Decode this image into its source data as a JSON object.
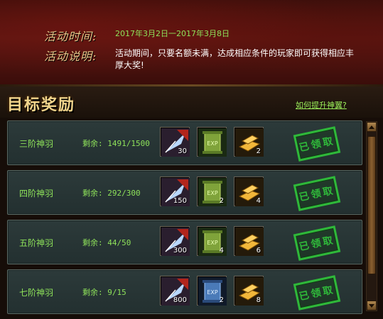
{
  "header": {
    "time_label": "活动时间:",
    "time_value": "2017年3月2日一2017年3月8日",
    "desc_label": "活动说明:",
    "desc_value": "活动期间，只要名额未满，达成相应条件的玩家即可获得相应丰厚大奖!"
  },
  "section": {
    "title": "目标奖励",
    "link": "如何提升神翼?"
  },
  "rewards": [
    {
      "tier": "三阶神羽",
      "remain": "剩余: 1491/1500",
      "items": [
        {
          "icon": "feather-icon",
          "qty": "30"
        },
        {
          "icon": "exp-scroll-icon",
          "qty": ""
        },
        {
          "icon": "gold-bar-icon",
          "qty": "2"
        }
      ],
      "stamp": "已领取"
    },
    {
      "tier": "四阶神羽",
      "remain": "剩余: 292/300",
      "items": [
        {
          "icon": "feather-icon",
          "qty": "150"
        },
        {
          "icon": "exp-scroll-icon",
          "qty": "2"
        },
        {
          "icon": "gold-bar-icon",
          "qty": "4"
        }
      ],
      "stamp": "已领取"
    },
    {
      "tier": "五阶神羽",
      "remain": "剩余: 44/50",
      "items": [
        {
          "icon": "feather-icon",
          "qty": "300"
        },
        {
          "icon": "exp-scroll-icon",
          "qty": "4"
        },
        {
          "icon": "gold-bar-icon",
          "qty": "6"
        }
      ],
      "stamp": "已领取"
    },
    {
      "tier": "七阶神羽",
      "remain": "剩余: 9/15",
      "items": [
        {
          "icon": "feather-icon",
          "qty": "800"
        },
        {
          "icon": "exp-scroll-blue-icon",
          "qty": "2"
        },
        {
          "icon": "gold-bar-icon",
          "qty": "8"
        }
      ],
      "stamp": "已领取"
    }
  ],
  "colors": {
    "label_gold": "#e9c68a",
    "text_green": "#8ee25a",
    "stamp_green": "#2fb83a"
  }
}
